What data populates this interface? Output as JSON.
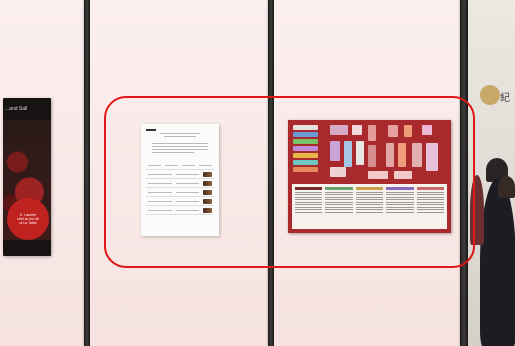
{
  "left_poster": {
    "tag_text": "...and Sall",
    "circle_text_lines": [
      "K. Laurent",
      "chef au bol de",
      "ut La Table"
    ]
  },
  "right_booth": {
    "sign_text": "紀"
  },
  "colors": {
    "highlight": "#e01717",
    "map_board": "#a82a2c",
    "wall": "#f7e3df",
    "pole": "#1b1b1b"
  }
}
